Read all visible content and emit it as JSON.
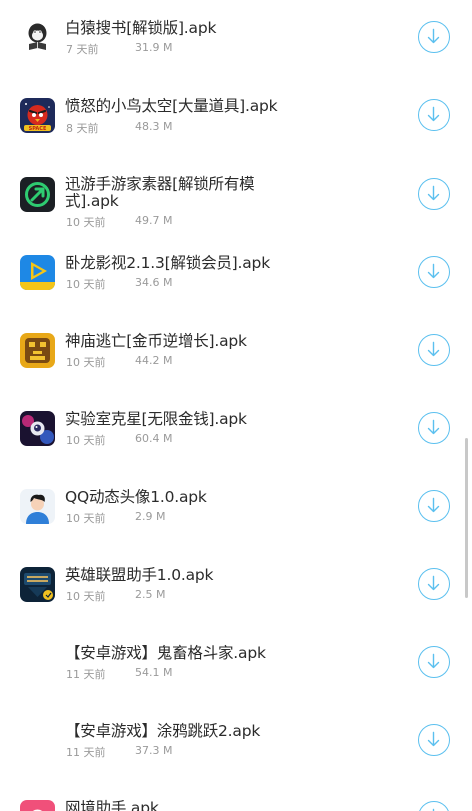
{
  "colors": {
    "accent": "#5bc0ef",
    "title_text": "#2b2b2b",
    "meta_text": "#9a9a9a",
    "background": "#ffffff"
  },
  "apps": [
    {
      "name": "白猿搜书[解锁版].apk",
      "age": "7 天前",
      "size": "31.9 M",
      "icon": "ape-book-icon"
    },
    {
      "name": "愤怒的小鸟太空[大量道具].apk",
      "age": "8 天前",
      "size": "48.3 M",
      "icon": "angry-birds-space-icon"
    },
    {
      "name": "迅游手游家素器[解锁所有模式].apk",
      "age": "10 天前",
      "size": "49.7 M",
      "icon": "xunyou-icon"
    },
    {
      "name": "卧龙影视2.1.3[解锁会员].apk",
      "age": "10 天前",
      "size": "34.6 M",
      "icon": "play-video-icon"
    },
    {
      "name": "神庙逃亡[金币逆增长].apk",
      "age": "10 天前",
      "size": "44.2 M",
      "icon": "temple-run-icon"
    },
    {
      "name": "实验室克星[无限金钱].apk",
      "age": "10 天前",
      "size": "60.4 M",
      "icon": "lab-game-icon"
    },
    {
      "name": "QQ动态头像1.0.apk",
      "age": "10 天前",
      "size": "2.9 M",
      "icon": "avatar-person-icon"
    },
    {
      "name": "英雄联盟助手1.0.apk",
      "age": "10 天前",
      "size": "2.5 M",
      "icon": "lol-helper-icon"
    },
    {
      "name": "【安卓游戏】鬼畜格斗家.apk",
      "age": "11 天前",
      "size": "54.1 M",
      "icon": ""
    },
    {
      "name": "【安卓游戏】涂鸦跳跃2.apk",
      "age": "11 天前",
      "size": "37.3 M",
      "icon": ""
    },
    {
      "name": "网境助手.apk",
      "age": "",
      "size": "",
      "icon": "pink-app-icon"
    }
  ]
}
